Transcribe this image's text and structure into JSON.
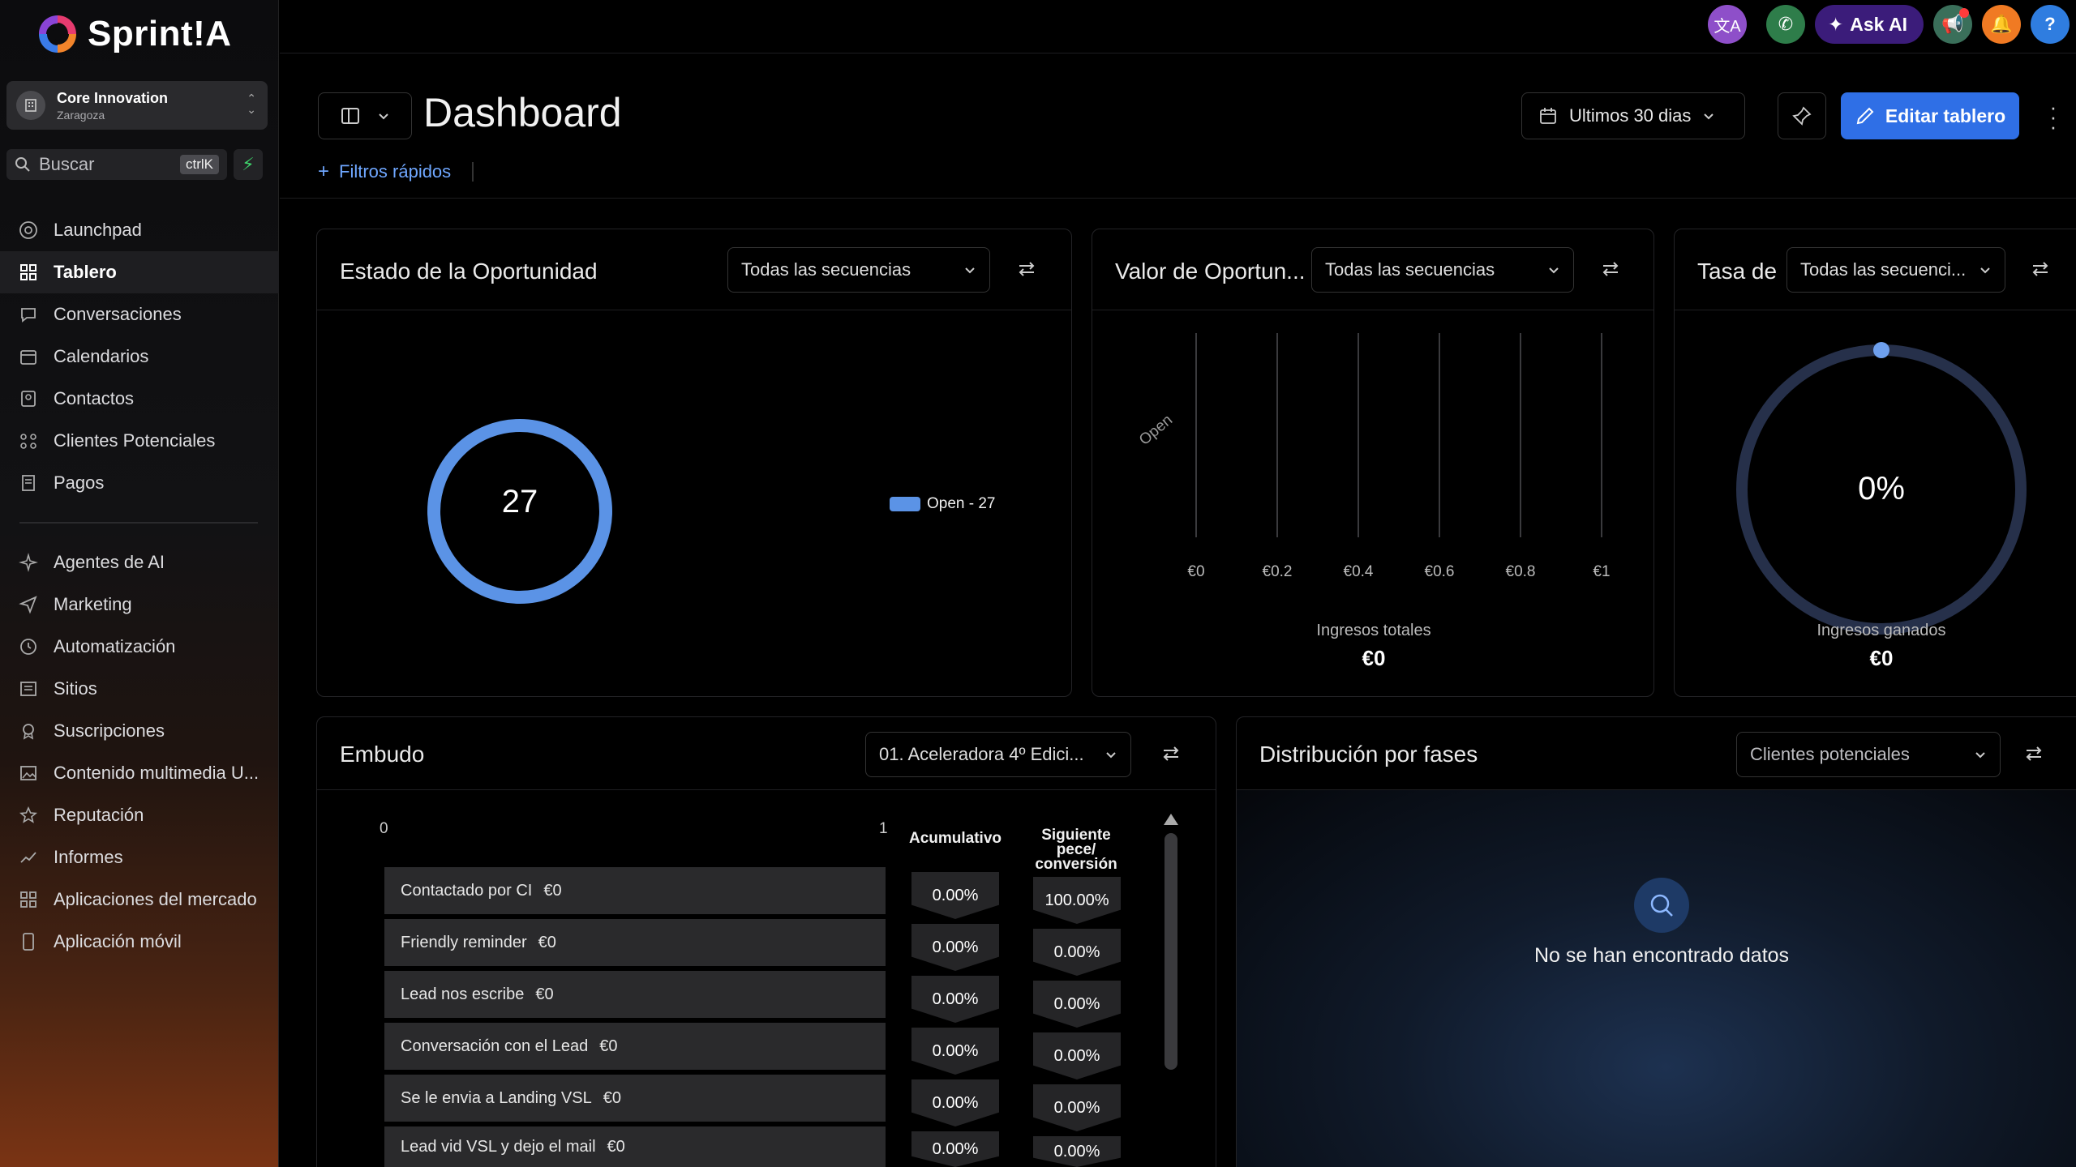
{
  "brand": {
    "name": "Sprint!A"
  },
  "account": {
    "name": "Core Innovation",
    "location": "Zaragoza"
  },
  "search": {
    "placeholder": "Buscar",
    "shortcut": "ctrlK"
  },
  "nav": {
    "primary": [
      {
        "label": "Launchpad",
        "icon": "launchpad-icon"
      },
      {
        "label": "Tablero",
        "icon": "grid-icon",
        "active": true
      },
      {
        "label": "Conversaciones",
        "icon": "chat-icon"
      },
      {
        "label": "Calendarios",
        "icon": "calendar-icon"
      },
      {
        "label": "Contactos",
        "icon": "contacts-icon"
      },
      {
        "label": "Clientes Potenciales",
        "icon": "leads-icon"
      },
      {
        "label": "Pagos",
        "icon": "payments-icon"
      }
    ],
    "secondary": [
      {
        "label": "Agentes de AI",
        "icon": "sparkle-icon"
      },
      {
        "label": "Marketing",
        "icon": "send-icon"
      },
      {
        "label": "Automatización",
        "icon": "automation-icon"
      },
      {
        "label": "Sitios",
        "icon": "sites-icon"
      },
      {
        "label": "Suscripciones",
        "icon": "subscriptions-icon"
      },
      {
        "label": "Contenido multimedia U...",
        "icon": "media-icon"
      },
      {
        "label": "Reputación",
        "icon": "star-icon"
      },
      {
        "label": "Informes",
        "icon": "trend-icon"
      },
      {
        "label": "Aplicaciones del mercado",
        "icon": "apps-icon"
      },
      {
        "label": "Aplicación móvil",
        "icon": "mobile-icon"
      }
    ]
  },
  "topbar": {
    "ask_ai": "Ask AI",
    "colors": {
      "translate": "#8e4fc9",
      "phone": "#2e7d4a",
      "announce": "#3a6f5a",
      "bell": "#f07a23",
      "help": "#2f7de0"
    }
  },
  "header": {
    "title": "Dashboard",
    "quick_filters": "Filtros rápidos",
    "date_range": "Ultimos 30 dias",
    "edit": "Editar tablero"
  },
  "cards": {
    "estado": {
      "title": "Estado de la Oportunidad",
      "filter": "Todas las secuencias",
      "total": "27",
      "legend": "Open - 27",
      "color": "#5b93e6"
    },
    "valor": {
      "title": "Valor de Oportun...",
      "filter": "Todas las secuencias",
      "category": "Open",
      "metric_label": "Ingresos totales",
      "metric_value": "€0"
    },
    "tasa": {
      "title": "Tasa de",
      "filter": "Todas las secuenci...",
      "percent": "0%",
      "metric_label": "Ingresos ganados",
      "metric_value": "€0"
    },
    "embudo": {
      "title": "Embudo",
      "filter": "01. Aceleradora 4º Edici...",
      "axis_min": "0",
      "axis_max": "1",
      "col_acum": "Acumulativo",
      "col_sig": "Siguiente\npece/\nconversión",
      "rows": [
        {
          "name": "Contactado por CI",
          "value": "€0",
          "acum": "0.00%",
          "sig": "100.00%"
        },
        {
          "name": "Friendly reminder",
          "value": "€0",
          "acum": "0.00%",
          "sig": "0.00%"
        },
        {
          "name": "Lead nos escribe",
          "value": "€0",
          "acum": "0.00%",
          "sig": "0.00%"
        },
        {
          "name": "Conversación con el Lead",
          "value": "€0",
          "acum": "0.00%",
          "sig": "0.00%"
        },
        {
          "name": "Se le envia a Landing VSL",
          "value": "€0",
          "acum": "0.00%",
          "sig": "0.00%"
        },
        {
          "name": "Lead vid VSL y dejo el mail",
          "value": "€0",
          "acum": "0.00%",
          "sig": "0.00%"
        }
      ]
    },
    "distribucion": {
      "title": "Distribución por fases",
      "filter": "Clientes potenciales",
      "empty": "No se han encontrado datos"
    }
  },
  "chart_data": [
    {
      "type": "pie",
      "categories": [
        "Open"
      ],
      "values": [
        27
      ],
      "legend": "right"
    },
    {
      "type": "bar",
      "orientation": "horizontal",
      "categories": [
        "Open"
      ],
      "values": [
        0
      ],
      "x_ticks": [
        "€0",
        "€0.2",
        "€0.4",
        "€0.6",
        "€0.8",
        "€1"
      ],
      "xlim": [
        0,
        1
      ],
      "grid": true
    }
  ]
}
